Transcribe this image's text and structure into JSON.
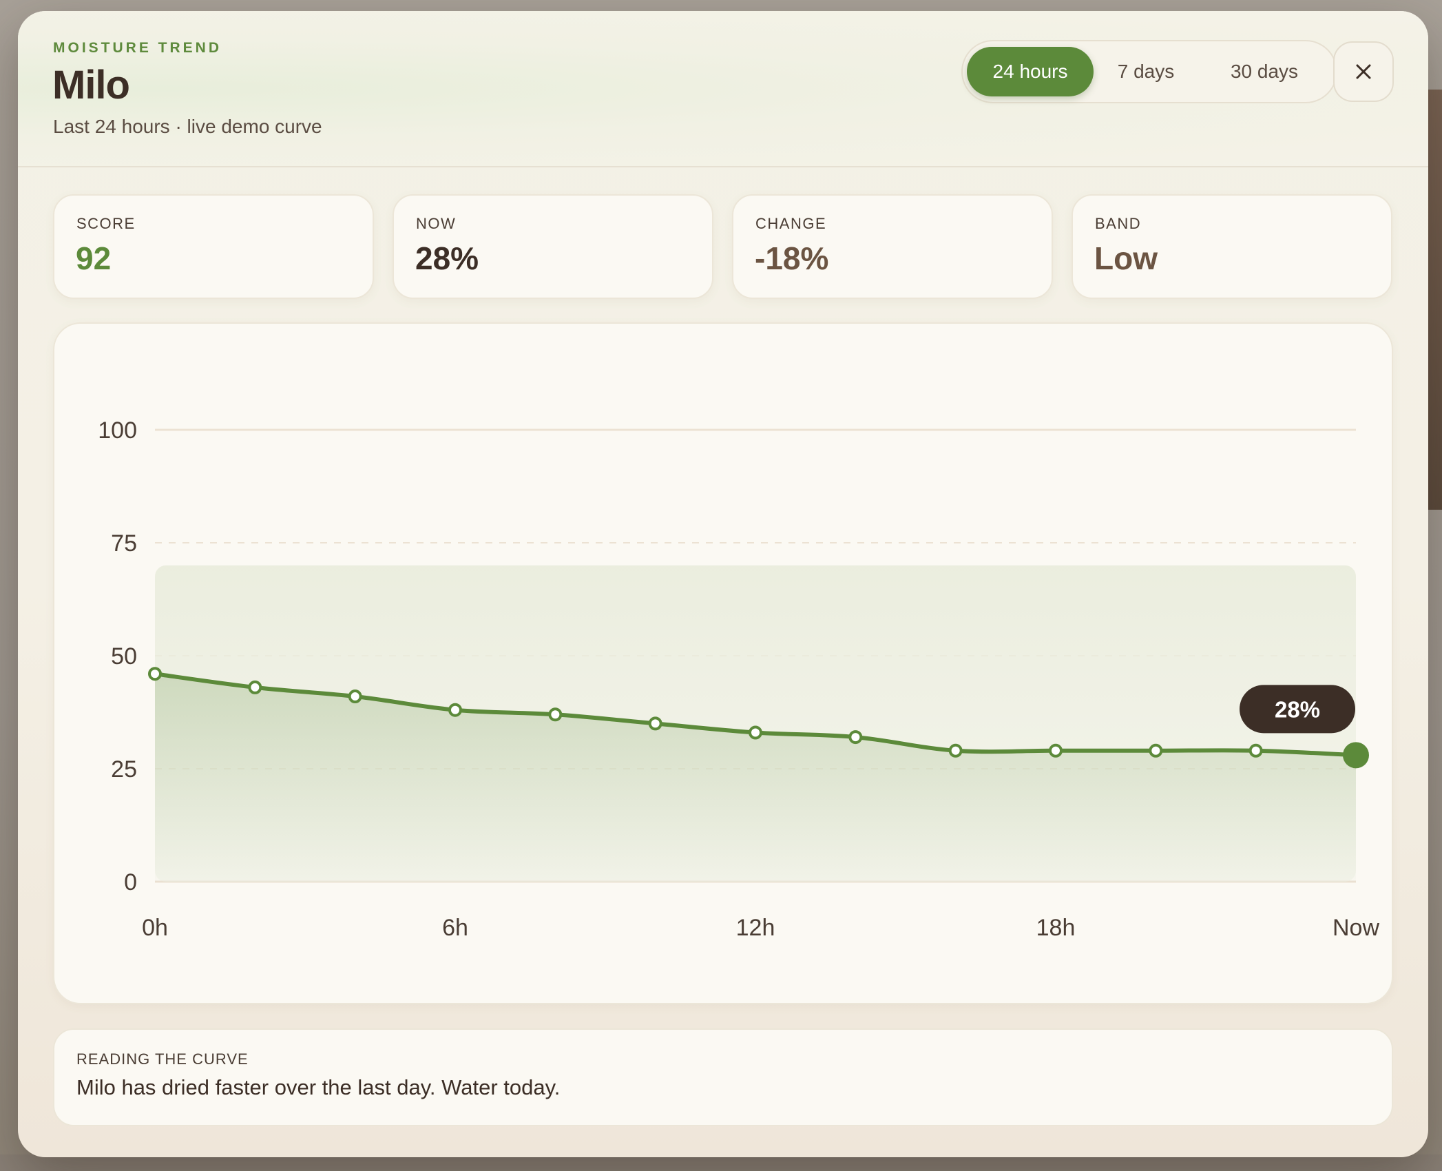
{
  "header": {
    "eyebrow": "MOISTURE TREND",
    "title": "Milo",
    "subtitle": "Last 24 hours · live demo curve"
  },
  "ranges": [
    {
      "label": "24 hours",
      "active": true
    },
    {
      "label": "7 days",
      "active": false
    },
    {
      "label": "30 days",
      "active": false
    }
  ],
  "close_icon": "close-icon",
  "stats": {
    "score": {
      "label": "SCORE",
      "value": "92"
    },
    "now": {
      "label": "NOW",
      "value": "28%"
    },
    "change": {
      "label": "CHANGE",
      "value": "-18%"
    },
    "band": {
      "label": "BAND",
      "value": "Low"
    }
  },
  "note": {
    "label": "READING THE CURVE",
    "text": "Milo has dried faster over the last day. Water today."
  },
  "colors": {
    "accent": "#5c8a3a",
    "text_dark": "#3c2e26",
    "tooltip_bg": "#3c2e26"
  },
  "chart_data": {
    "type": "area",
    "y_ticks": [
      "0",
      "25",
      "50",
      "75",
      "100"
    ],
    "x_tick_labels": [
      "0h",
      "6h",
      "12h",
      "18h",
      "Now"
    ],
    "ylim": [
      0,
      100
    ],
    "xlim": [
      0,
      24
    ],
    "x": [
      0,
      2,
      4,
      6,
      8,
      10,
      12,
      14,
      16,
      18,
      20,
      22,
      24
    ],
    "series": [
      {
        "values": [
          46,
          43,
          41,
          38,
          37,
          35,
          33,
          32,
          29,
          29,
          29,
          29,
          28
        ]
      }
    ],
    "current_label": "28%",
    "grid": true
  }
}
